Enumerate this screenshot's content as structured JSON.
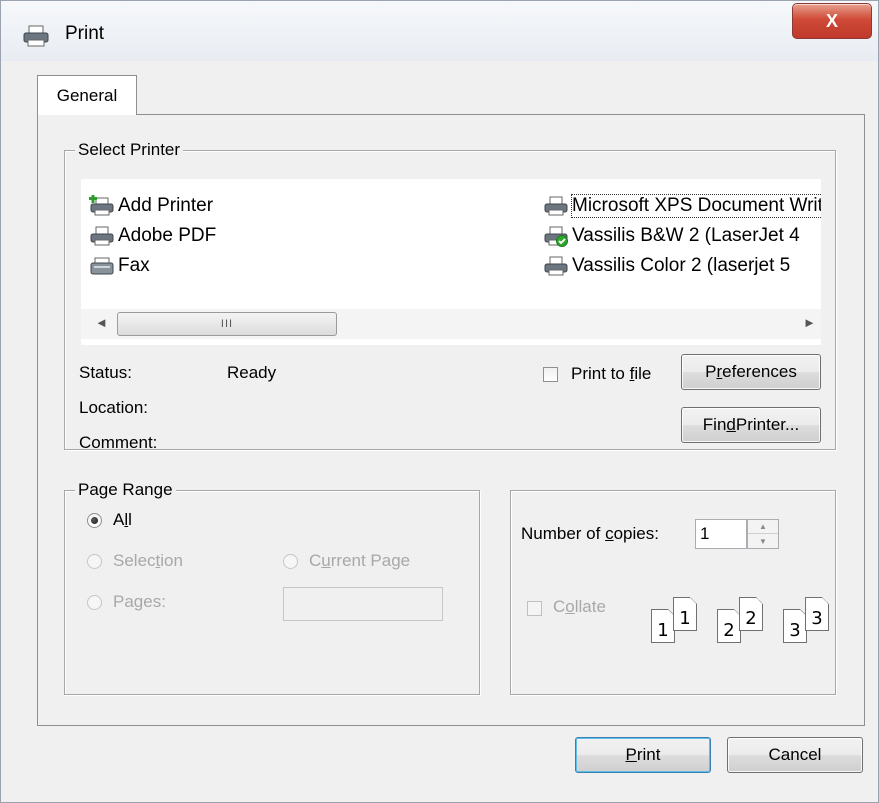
{
  "window": {
    "title": "Print",
    "close_glyph": "X"
  },
  "tabs": [
    {
      "label": "General",
      "selected": true
    }
  ],
  "select_printer": {
    "legend": "Select Printer",
    "printers": [
      {
        "name": "Add Printer",
        "icon": "add-printer-icon"
      },
      {
        "name": "Adobe PDF",
        "icon": "printer-icon"
      },
      {
        "name": "Fax",
        "icon": "fax-icon"
      },
      {
        "name": "Microsoft XPS Document Writer",
        "icon": "printer-icon",
        "selected": true
      },
      {
        "name": "Vassilis B&W 2 (LaserJet 4",
        "icon": "default-printer-icon"
      },
      {
        "name": "Vassilis Color 2 (laserjet 5",
        "icon": "printer-icon"
      }
    ],
    "scroll_left": "◄",
    "scroll_right": "►",
    "scroll_thumb_grip": "III",
    "status_label": "Status:",
    "status_value": "Ready",
    "location_label": "Location:",
    "location_value": "",
    "comment_label": "Comment:",
    "comment_value": "",
    "print_to_file": {
      "label_pre": "Print to ",
      "label_mnemonic": "f",
      "label_post": "ile",
      "checked": false
    },
    "preferences_button": {
      "pre": "P",
      "mnemonic": "r",
      "post": "eferences"
    },
    "find_printer_button": {
      "pre": "Fin",
      "mnemonic": "d",
      "post": " Printer..."
    }
  },
  "page_range": {
    "legend": "Page Range",
    "all": {
      "pre": "A",
      "mnemonic": "l",
      "post": "l",
      "checked": true
    },
    "selection": {
      "pre": "Selec",
      "mnemonic": "t",
      "post": "ion",
      "enabled": false
    },
    "current_page": {
      "pre": "C",
      "mnemonic": "u",
      "post": "rrent Page",
      "enabled": false
    },
    "pages": {
      "pre": "Pa",
      "mnemonic": "g",
      "post": "es:",
      "enabled": false
    },
    "pages_value": ""
  },
  "copies": {
    "label_pre": "Number of ",
    "label_mnemonic": "c",
    "label_post": "opies:",
    "value": "1",
    "collate": {
      "pre": "C",
      "mnemonic": "o",
      "post": "llate",
      "checked": false,
      "enabled": false
    },
    "collate_pages": [
      "1",
      "1",
      "2",
      "2",
      "3",
      "3"
    ]
  },
  "footer": {
    "print_button": {
      "pre": "",
      "mnemonic": "P",
      "post": "rint"
    },
    "cancel_button": "Cancel"
  }
}
